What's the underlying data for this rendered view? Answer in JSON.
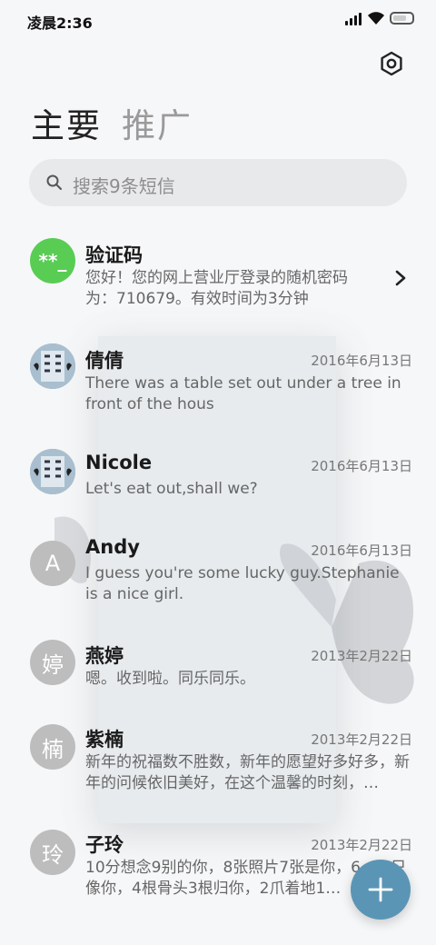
{
  "status_bar": {
    "time": "凌晨2:36",
    "icons": [
      "signal-icon",
      "wifi-icon",
      "battery-icon"
    ]
  },
  "header": {
    "settings_icon": "gear-icon"
  },
  "tabs": [
    {
      "label": "主要",
      "active": true
    },
    {
      "label": "推广",
      "active": false
    }
  ],
  "search": {
    "placeholder": "搜索9条短信",
    "icon": "search-icon"
  },
  "messages": [
    {
      "avatar": "**_",
      "avatar_type": "verification-code",
      "name": "验证码",
      "date": "",
      "preview": "您好！您的网上营业厅登录的随机密码为：710679。有效时间为3分钟",
      "has_chevron": true
    },
    {
      "avatar": "",
      "avatar_type": "photo",
      "name": "倩倩",
      "date": "2016年6月13日",
      "preview": "There was a table set out under a tree in front of the hous"
    },
    {
      "avatar": "",
      "avatar_type": "photo",
      "name": "Nicole",
      "date": "2016年6月13日",
      "preview": "Let's eat out,shall we?"
    },
    {
      "avatar": "A",
      "avatar_type": "letter",
      "name": "Andy",
      "date": "2016年6月13日",
      "preview": "I guess you're some lucky guy.Stephanie is a nice girl."
    },
    {
      "avatar": "婷",
      "avatar_type": "letter",
      "name": "燕婷",
      "date": "2013年2月22日",
      "preview": "嗯。收到啦。同乐同乐。"
    },
    {
      "avatar": "楠",
      "avatar_type": "letter",
      "name": "紫楠",
      "date": "2013年2月22日",
      "preview": "新年的祝福数不胜数，新年的愿望好多好多，新年的问候依旧美好，在这个温馨的时刻，…"
    },
    {
      "avatar": "玲",
      "avatar_type": "letter",
      "name": "子玲",
      "date": "2013年2月22日",
      "preview": "10分想念9别的你，8张照片7张是你，6… 5只像你，4根骨头3根归你，2爪着地1…"
    }
  ],
  "fab": {
    "icon": "plus-icon"
  },
  "colors": {
    "accent": "#5b95b5",
    "code_avatar": "#59cc54",
    "letter_avatar": "#bdbdbd"
  }
}
